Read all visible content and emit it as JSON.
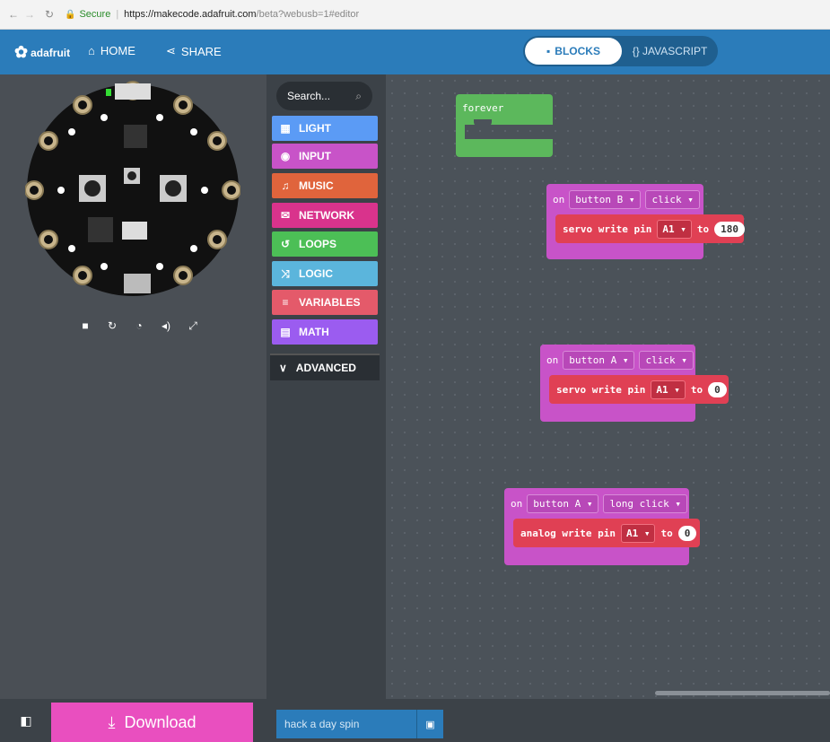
{
  "browser": {
    "secure_label": "Secure",
    "url_main": "https://makecode.adafruit.com",
    "url_rest": "/beta?webusb=1#editor"
  },
  "header": {
    "brand": "adafruit",
    "home_label": "HOME",
    "share_label": "SHARE",
    "blocks_label": "BLOCKS",
    "javascript_label": "{} JAVASCRIPT"
  },
  "toolbox": {
    "search_placeholder": "Search...",
    "categories": [
      {
        "label": "LIGHT",
        "color": "#5b9bf5",
        "icon": "grid-icon"
      },
      {
        "label": "INPUT",
        "color": "#c853c8",
        "icon": "target-icon"
      },
      {
        "label": "MUSIC",
        "color": "#e0643c",
        "icon": "headphones-icon"
      },
      {
        "label": "NETWORK",
        "color": "#d9338c",
        "icon": "chat-icon"
      },
      {
        "label": "LOOPS",
        "color": "#4cbf56",
        "icon": "loop-icon"
      },
      {
        "label": "LOGIC",
        "color": "#5bb5dc",
        "icon": "shuffle-icon"
      },
      {
        "label": "VARIABLES",
        "color": "#e45a6a",
        "icon": "list-icon"
      },
      {
        "label": "MATH",
        "color": "#9b5cf0",
        "icon": "calculator-icon"
      }
    ],
    "advanced_label": "ADVANCED"
  },
  "workspace": {
    "forever_label": "forever",
    "event1": {
      "on": "on",
      "button": "button B ▾",
      "action": "click ▾",
      "inner_label": "servo write pin",
      "pin": "A1 ▾",
      "to": "to",
      "value": "180"
    },
    "event2": {
      "on": "on",
      "button": "button A ▾",
      "action": "click ▾",
      "inner_label": "servo write pin",
      "pin": "A1 ▾",
      "to": "to",
      "value": "0"
    },
    "event3": {
      "on": "on",
      "button": "button A ▾",
      "action": "long click ▾",
      "inner_label": "analog write pin",
      "pin": "A1 ▾",
      "to": "to",
      "value": "0"
    }
  },
  "footer": {
    "download_label": "Download",
    "project_name": "hack a day spin"
  },
  "colors": {
    "topbar": "#2b7cba",
    "event_block": "#c853c8",
    "pins_block": "#e04054",
    "loops_block": "#5cb85c",
    "download": "#e94fbf"
  }
}
